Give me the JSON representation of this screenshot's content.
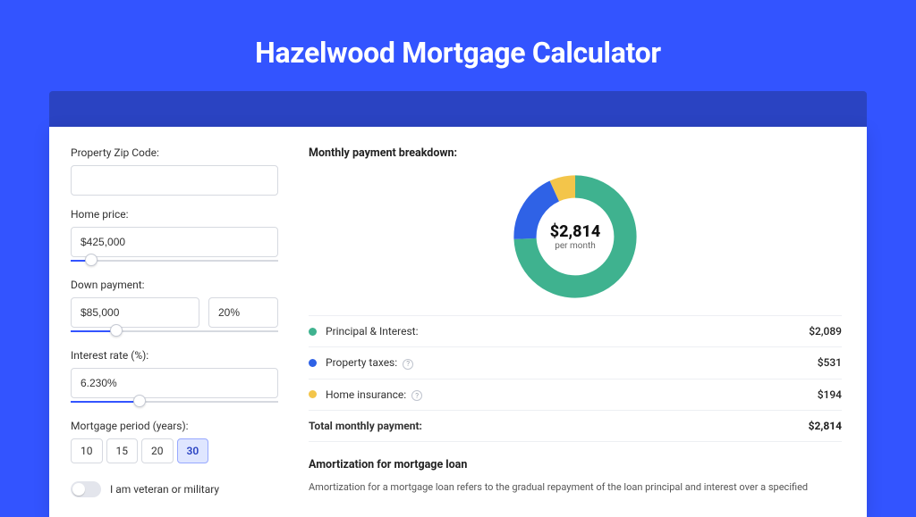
{
  "hero_title": "Hazelwood Mortgage Calculator",
  "left": {
    "zip_label": "Property Zip Code:",
    "zip_value": "",
    "home_price_label": "Home price:",
    "home_price_value": "$425,000",
    "down_payment_label": "Down payment:",
    "down_payment_value": "$85,000",
    "down_payment_pct": "20%",
    "interest_label": "Interest rate (%):",
    "interest_value": "6.230%",
    "period_label": "Mortgage period (years):",
    "periods": [
      "10",
      "15",
      "20",
      "30"
    ],
    "period_active": "30",
    "veteran_label": "I am veteran or military"
  },
  "right": {
    "breakdown_title": "Monthly payment breakdown:",
    "donut_amount": "$2,814",
    "donut_sub": "per month",
    "rows": [
      {
        "color": "#3fb28f",
        "label": "Principal & Interest:",
        "value": "$2,089"
      },
      {
        "color": "#2f62e6",
        "label": "Property taxes:",
        "value": "$531",
        "info": true
      },
      {
        "color": "#f3c54a",
        "label": "Home insurance:",
        "value": "$194",
        "info": true
      }
    ],
    "total_label": "Total monthly payment:",
    "total_value": "$2,814",
    "amort_title": "Amortization for mortgage loan",
    "amort_text": "Amortization for a mortgage loan refers to the gradual repayment of the loan principal and interest over a specified"
  },
  "chart_data": {
    "type": "pie",
    "title": "Monthly payment breakdown",
    "series": [
      {
        "name": "Principal & Interest",
        "value": 2089,
        "color": "#3fb28f"
      },
      {
        "name": "Property taxes",
        "value": 531,
        "color": "#2f62e6"
      },
      {
        "name": "Home insurance",
        "value": 194,
        "color": "#f3c54a"
      }
    ],
    "total": 2814,
    "center_label": "$2,814 per month"
  }
}
